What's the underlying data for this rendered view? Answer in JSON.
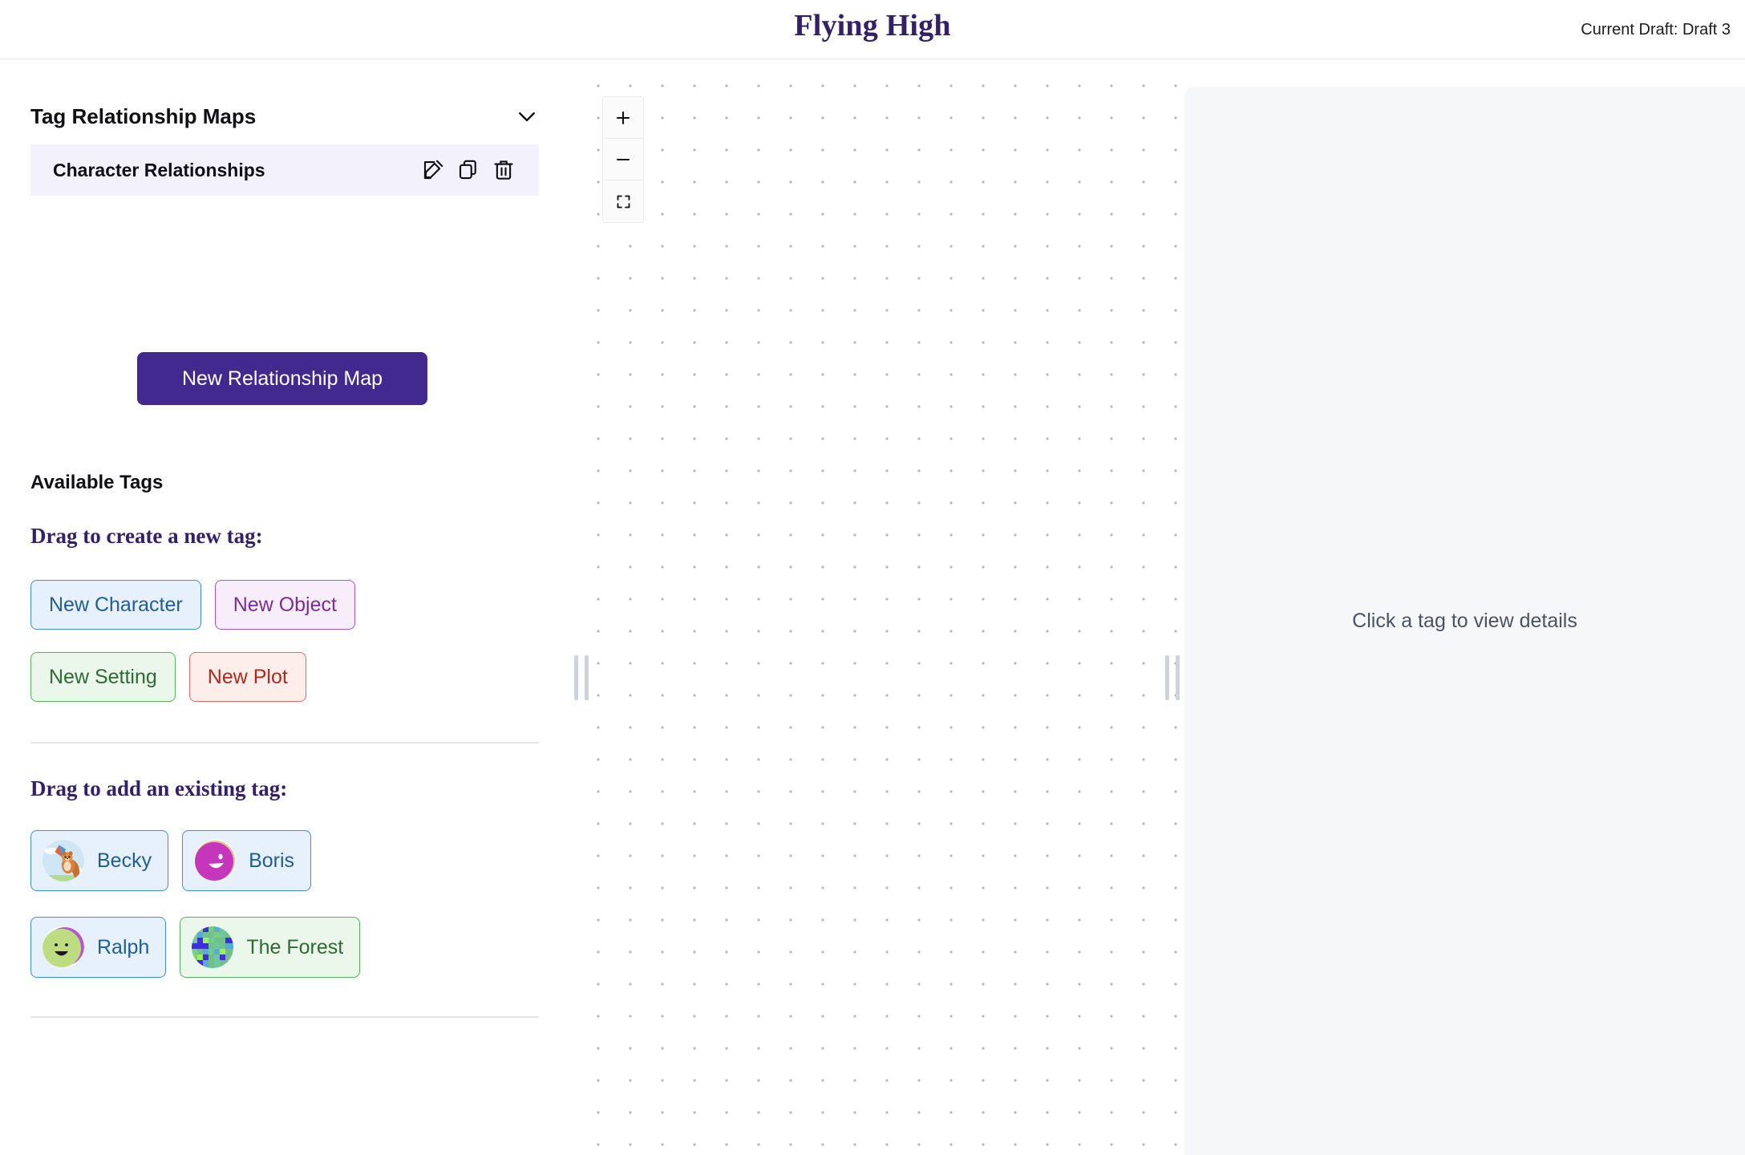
{
  "header": {
    "title": "Flying High",
    "draft_indicator": "Current Draft: Draft 3"
  },
  "sidebar": {
    "section_title": "Tag Relationship Maps",
    "collapse_icon": "chevron-down-icon",
    "maps": [
      {
        "name": "Character Relationships",
        "actions": [
          {
            "icon": "edit-icon",
            "label": "Edit"
          },
          {
            "icon": "duplicate-icon",
            "label": "Duplicate"
          },
          {
            "icon": "trash-icon",
            "label": "Delete"
          }
        ]
      }
    ],
    "new_map_button": "New Relationship Map",
    "available_tags_label": "Available Tags",
    "new_tag_hint": "Drag to create a new tag:",
    "new_tag_chips": [
      {
        "label": "New Character",
        "kind": "character"
      },
      {
        "label": "New Object",
        "kind": "object"
      },
      {
        "label": "New Setting",
        "kind": "setting"
      },
      {
        "label": "New Plot",
        "kind": "plot"
      }
    ],
    "existing_tag_hint": "Drag to add an existing tag:",
    "existing_tags": [
      {
        "label": "Becky",
        "kind": "character",
        "avatar": "squirrel-kite-avatar"
      },
      {
        "label": "Boris",
        "kind": "character",
        "avatar": "magenta-smiley-avatar"
      },
      {
        "label": "Ralph",
        "kind": "character",
        "avatar": "green-smiley-avatar"
      },
      {
        "label": "The Forest",
        "kind": "setting",
        "avatar": "pixel-mosaic-avatar"
      }
    ]
  },
  "canvas": {
    "zoom_in_label": "+",
    "zoom_out_label": "−",
    "fit_icon": "fit-to-screen-icon"
  },
  "detail_panel": {
    "placeholder": "Click a tag to view details"
  },
  "colors": {
    "brand_purple": "#342068",
    "button_purple": "#42298f",
    "character": "#3d8fd8",
    "object": "#b152cd",
    "setting": "#54b35a",
    "plot": "#e26a5c",
    "panel_bg": "#f6f7f9"
  }
}
